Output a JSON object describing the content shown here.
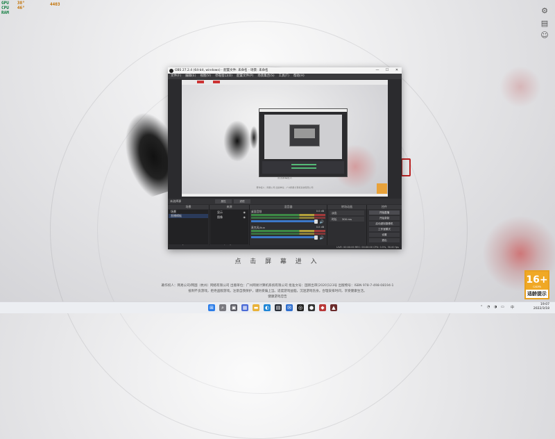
{
  "perf": {
    "gpu_label": "GPU",
    "gpu_val": "38°",
    "cpu_label": "CPU",
    "cpu_val": "46°",
    "mem_label": "RAM",
    "mem_val": "4403"
  },
  "obs": {
    "title": "OBS 27.2.4 (64-bit, windows) - 配置文件: 未命名 - 场景: 未命名",
    "window_controls": [
      "—",
      "☐",
      "✕"
    ],
    "menu": [
      "文件(F)",
      "编辑(E)",
      "视图(V)",
      "停靠窗口(D)",
      "配置文件(P)",
      "场景集合(S)",
      "工具(T)",
      "帮助(H)"
    ],
    "preview": {
      "caption": "点击屏幕进入",
      "legal": "著作权人：网易公司  出版单位：广州网易计算机系统有限公司"
    },
    "source_bar": {
      "label": "未选择源",
      "btn_props": "属性",
      "btn_filters": "滤镜"
    },
    "docks": {
      "scenes": {
        "title": "场景",
        "items": [
          "场景",
          "直播模板"
        ]
      },
      "sources": {
        "title": "来源",
        "items": [
          "显示",
          "图像"
        ]
      },
      "mixer": {
        "title": "混音器",
        "tracks": [
          {
            "name": "桌面音频",
            "db": "0.0 dB"
          },
          {
            "name": "麦克风/Aux",
            "db": "0.0 dB"
          }
        ]
      },
      "transitions": {
        "title": "转场动画",
        "type": "淡出",
        "duration_label": "时长",
        "duration": "300 ms"
      },
      "controls": {
        "title": "控件",
        "buttons": [
          "开始直播",
          "开始录制",
          "启动虚拟摄像机",
          "工作室模式",
          "设置",
          "退出"
        ]
      }
    },
    "status": "LIVE: 00:00:00   REC: 00:00:00   CPU: 0.5%, 30.00 fps"
  },
  "game": {
    "enter_text": "点 击 屏 幕 进 入",
    "legal_lines": [
      "著作权人：网易公司/韩国（杭州）网络有限公司  出版单位：广州网易计算机系统有限公司  批准文号：国新出审[2020]123号  出版物号：ISBN 978-7-498-08194-1",
      "抵制不良游戏，拒绝盗版游戏。注意自我保护，谨防受骗上当。适度游戏益脑，沉迷游戏伤身。合理安排时间，享受健康生活。",
      "健康游戏忠告"
    ],
    "age_rating": "16+",
    "age_sub": "CADPA",
    "age_label": "适龄提示"
  },
  "taskbar": {
    "time": "19:07",
    "date": "2022/3/18"
  },
  "colors": {
    "accent": "#3c78c8",
    "badge": "#f0a825"
  }
}
